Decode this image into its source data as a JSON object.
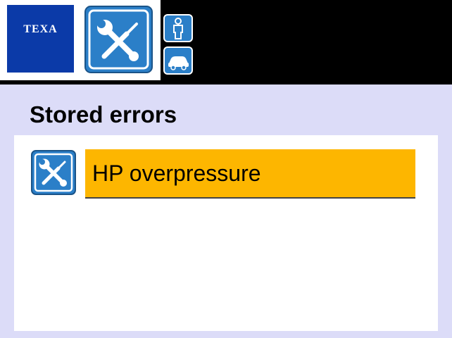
{
  "header": {
    "logo_text": "TEXA",
    "active_tool_icon": "tools-icon",
    "side_buttons": [
      {
        "icon": "person-icon"
      },
      {
        "icon": "car-icon"
      }
    ]
  },
  "main": {
    "title": "Stored errors",
    "errors": [
      {
        "icon": "tools-icon",
        "label": "HP overpressure",
        "selected": true
      }
    ]
  },
  "colors": {
    "topbar": "#000000",
    "logo_blue": "#0b3aa8",
    "icon_blue": "#2b7fc8",
    "content_bg": "#dcdcf8",
    "panel_bg": "#ffffff",
    "selection": "#fdb600"
  }
}
